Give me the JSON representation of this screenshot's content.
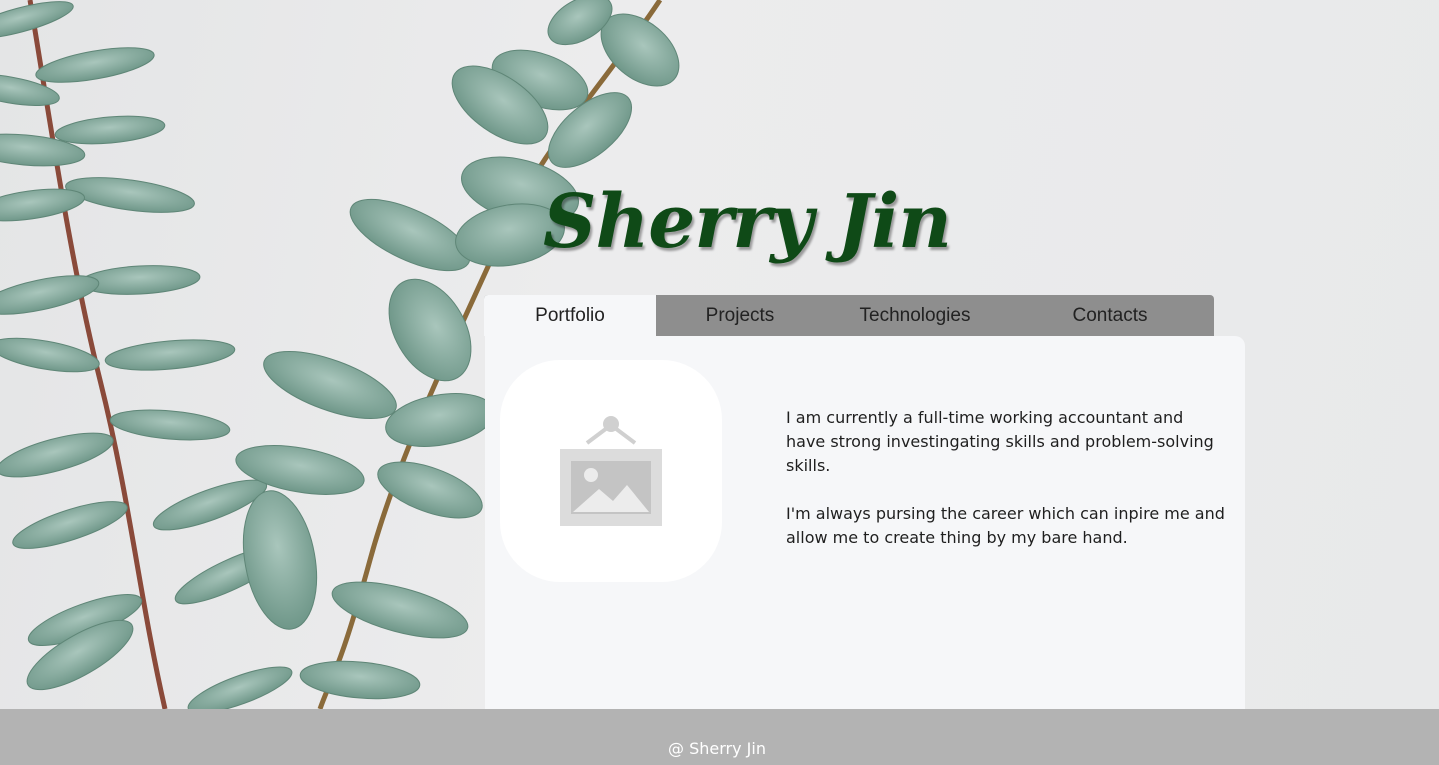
{
  "site": {
    "title": "Sherry Jin"
  },
  "tabs": [
    {
      "label": "Portfolio",
      "active": true
    },
    {
      "label": "Projects",
      "active": false
    },
    {
      "label": "Technologies",
      "active": false
    },
    {
      "label": "Contacts",
      "active": false
    }
  ],
  "profile": {
    "photo_icon": "image-placeholder-icon",
    "bio": [
      "I am currently a full-time working accountant and have strong investingating skills and problem-solving skills.",
      "I'm always pursing the career which can inpire me and allow me to create thing by my bare hand."
    ]
  },
  "footer": {
    "text": "@ Sherry Jin"
  },
  "colors": {
    "title": "#0f4a17",
    "tab_bar": "#8e8e8e",
    "panel": "#f6f7f9",
    "footer": "#b3b3b3",
    "leaf": "#7fa597",
    "stem": "#8a4a3a"
  }
}
